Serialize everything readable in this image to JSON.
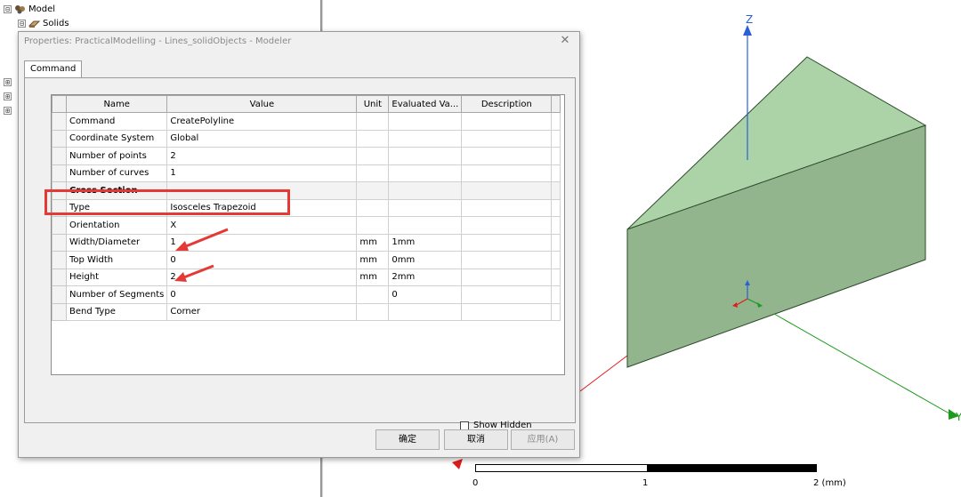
{
  "tree": {
    "root_label": "Model",
    "child_label": "Solids",
    "expand_glyph": "⊟",
    "collapsed_glyph": "⊞"
  },
  "viewport": {
    "axis_z_label": "Z",
    "axis_y_label": "Y",
    "colors": {
      "face_top": "#acd3a8",
      "face_front": "#93b58e",
      "edge": "#2e4a2c",
      "z_axis": "#2b5fd9",
      "y_axis": "#1e9a1e",
      "x_axis": "#e01c1c"
    },
    "scale": {
      "labels": [
        "0",
        "1",
        "2 (mm)"
      ]
    }
  },
  "dialog": {
    "title": "Properties: PracticalModelling - Lines_solidObjects - Modeler",
    "close_glyph": "✕",
    "tab_label": "Command",
    "columns": [
      "Name",
      "Value",
      "Unit",
      "Evaluated Va...",
      "Description"
    ],
    "rows": [
      {
        "name": "Command",
        "value": "CreatePolyline",
        "unit": "",
        "evaluated": "",
        "description": ""
      },
      {
        "name": "Coordinate System",
        "value": "Global",
        "unit": "",
        "evaluated": "",
        "description": ""
      },
      {
        "name": "Number of points",
        "value": "2",
        "unit": "",
        "evaluated": "",
        "description": ""
      },
      {
        "name": "Number of curves",
        "value": "1",
        "unit": "",
        "evaluated": "",
        "description": ""
      },
      {
        "name": "Cross Section",
        "value": "",
        "unit": "",
        "evaluated": "",
        "description": "",
        "section": true
      },
      {
        "name": "Type",
        "value": "Isosceles Trapezoid",
        "unit": "",
        "evaluated": "",
        "description": ""
      },
      {
        "name": "Orientation",
        "value": "X",
        "unit": "",
        "evaluated": "",
        "description": ""
      },
      {
        "name": "Width/Diameter",
        "value": "1",
        "unit": "mm",
        "evaluated": "1mm",
        "description": ""
      },
      {
        "name": "Top Width",
        "value": "0",
        "unit": "mm",
        "evaluated": "0mm",
        "description": ""
      },
      {
        "name": "Height",
        "value": "2",
        "unit": "mm",
        "evaluated": "2mm",
        "description": ""
      },
      {
        "name": "Number of Segments",
        "value": "0",
        "unit": "",
        "evaluated": "0",
        "description": ""
      },
      {
        "name": "Bend Type",
        "value": "Corner",
        "unit": "",
        "evaluated": "",
        "description": ""
      }
    ],
    "show_hidden_label": "Show Hidden",
    "show_hidden_checked": false,
    "buttons": {
      "ok": "确定",
      "cancel": "取消",
      "apply": "应用(A)"
    },
    "annotation_color": "#e53935"
  }
}
